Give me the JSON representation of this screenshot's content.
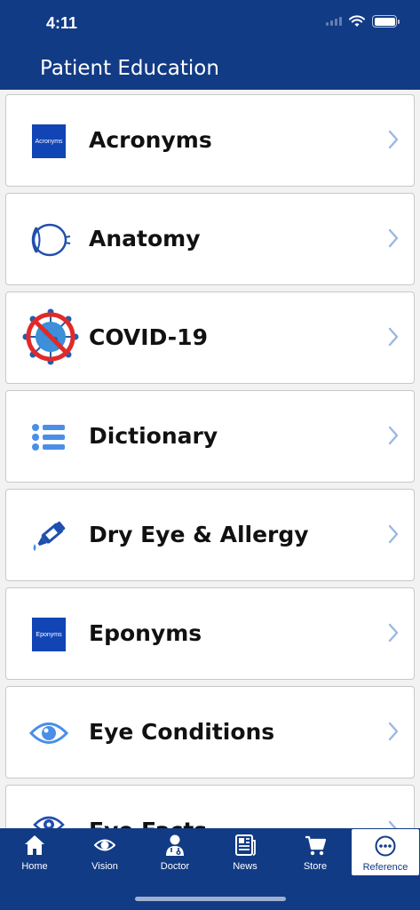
{
  "status": {
    "time": "4:11"
  },
  "header": {
    "title": "Patient Education"
  },
  "items": [
    {
      "label": "Acronyms",
      "badge": "Acronyms"
    },
    {
      "label": "Anatomy"
    },
    {
      "label": "COVID-19"
    },
    {
      "label": "Dictionary"
    },
    {
      "label": "Dry Eye & Allergy"
    },
    {
      "label": "Eponyms",
      "badge": "Eponyms"
    },
    {
      "label": "Eye Conditions"
    },
    {
      "label": "Eye Facts"
    }
  ],
  "tabs": [
    {
      "label": "Home",
      "icon": "home-icon"
    },
    {
      "label": "Vision",
      "icon": "eye-icon"
    },
    {
      "label": "Doctor",
      "icon": "doctor-icon"
    },
    {
      "label": "News",
      "icon": "newspaper-icon"
    },
    {
      "label": "Store",
      "icon": "cart-icon"
    },
    {
      "label": "Reference",
      "icon": "more-icon"
    }
  ],
  "colors": {
    "brand": "#123b85",
    "accent": "#4a8ee8",
    "badge": "#1145b5"
  }
}
